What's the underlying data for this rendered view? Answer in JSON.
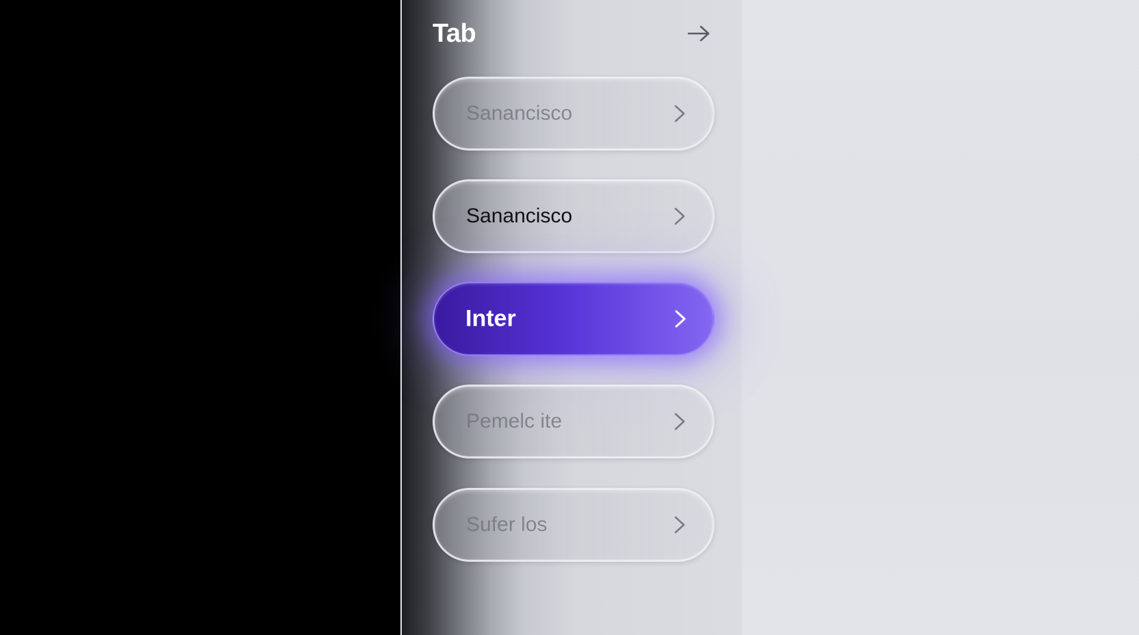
{
  "panel": {
    "title": "Tab",
    "items": [
      {
        "label": "Sanancisco",
        "state": "faded"
      },
      {
        "label": "Sanancisco",
        "state": "normal"
      },
      {
        "label": "Inter",
        "state": "active"
      },
      {
        "label": "Pemelc ite",
        "state": "faded"
      },
      {
        "label": "Sufer los",
        "state": "faded"
      }
    ]
  },
  "icons": {
    "header_action": "arrow-right-icon",
    "item_action": "chevron-right-icon"
  },
  "colors": {
    "accent": "#6a4ae8",
    "accent_dark": "#3a1aa0",
    "background_dark": "#000000",
    "background_light": "#e1e3e8"
  }
}
